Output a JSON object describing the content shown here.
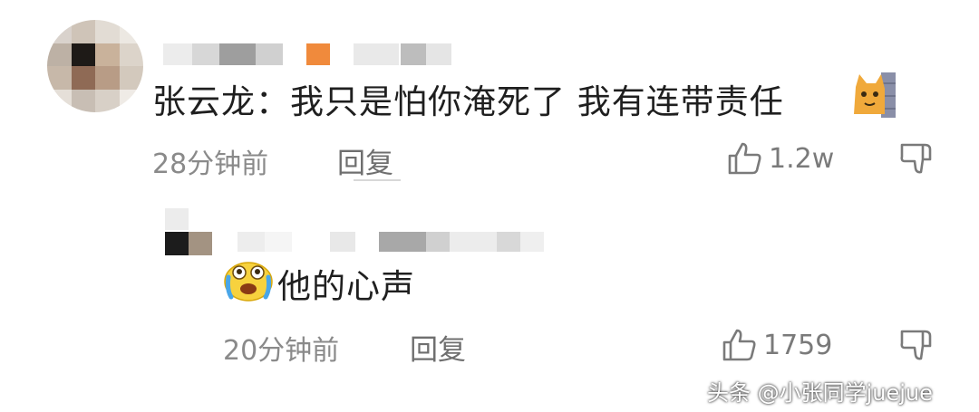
{
  "colors": {
    "text": "#1f1f1f",
    "meta": "#8a8a8a",
    "accent_orange": "#f08a3c"
  },
  "comments": [
    {
      "text": "张云龙：我只是怕你淹死了 我有连带责任",
      "emoji_icon": "cat-emoji-icon",
      "time": "28分钟前",
      "reply_label": "回复",
      "likes": "1.2w"
    }
  ],
  "replies": [
    {
      "emoji_icon": "crying-face-emoji-icon",
      "text": "他的心声",
      "time": "20分钟前",
      "reply_label": "回复",
      "likes": "1759"
    }
  ],
  "watermark": "头条 @小张同学juejue"
}
